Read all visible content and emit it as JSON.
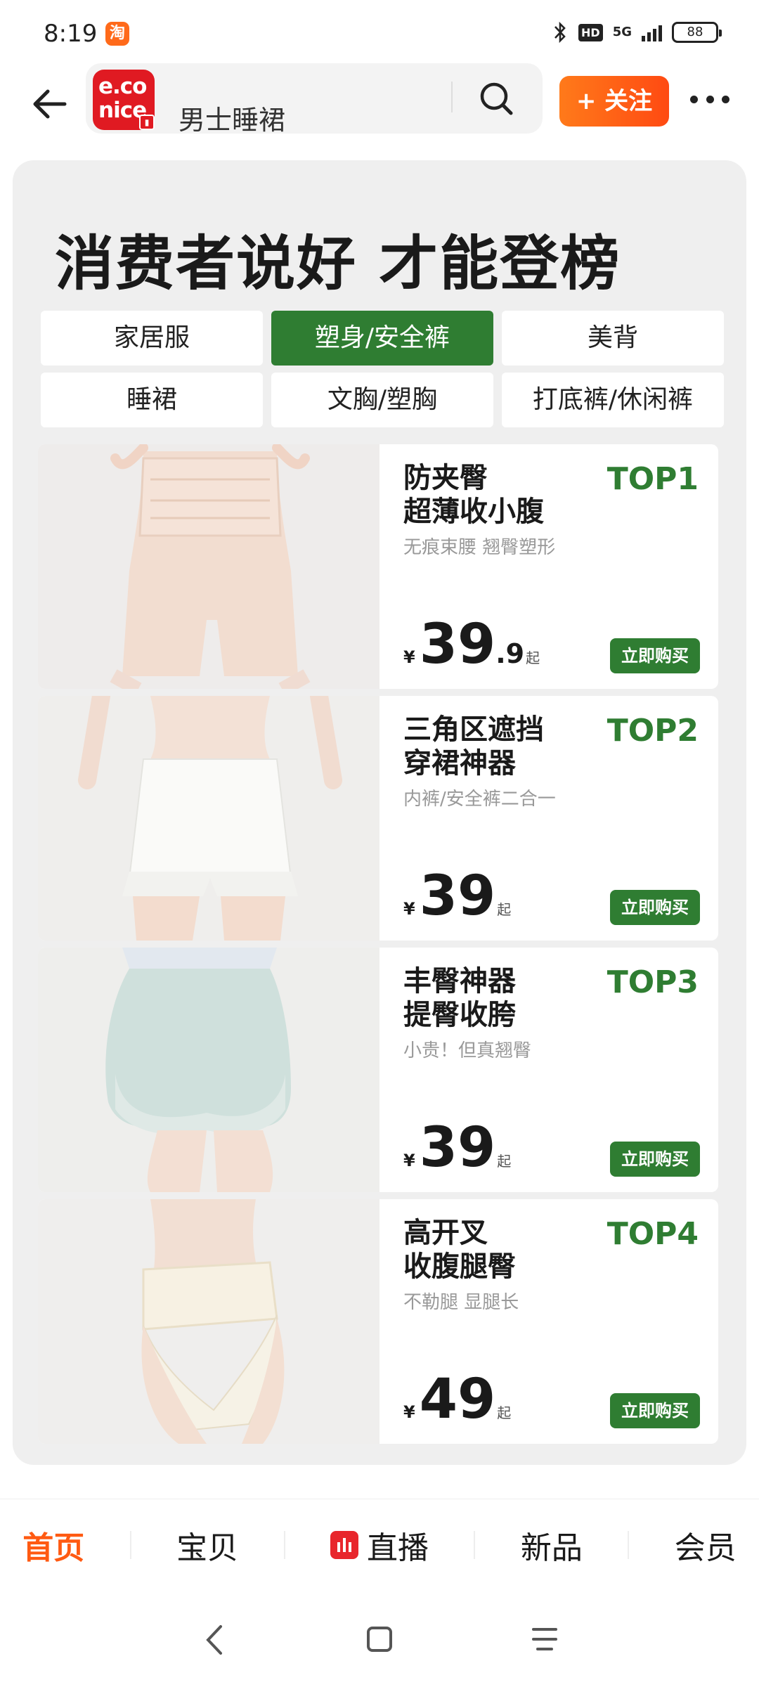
{
  "status_bar": {
    "time": "8:19",
    "app_badge": "淘",
    "hd": "HD",
    "network": "5G",
    "battery": "88"
  },
  "nav": {
    "logo_line1": "e.co",
    "logo_line2": "nice",
    "search_text": "男士睡裙",
    "follow_label": "+ 关注"
  },
  "panel": {
    "headline": "消费者说好 才能登榜",
    "categories": [
      "家居服",
      "塑身/安全裤",
      "美背",
      "睡裙",
      "文胸/塑胸",
      "打底裤/休闲裤"
    ],
    "active_category": "塑身/安全裤"
  },
  "products": [
    {
      "line1": "防夹臀",
      "line2": "超薄收小腹",
      "sub": "无痕束腰 翘臀塑形",
      "rank": "TOP1",
      "currency": "¥",
      "price_int": "39",
      "price_dec": ".9",
      "price_suffix": "起",
      "buy": "立即购买"
    },
    {
      "line1": "三角区遮挡",
      "line2": "穿裙神器",
      "sub": "内裤/安全裤二合一",
      "rank": "TOP2",
      "currency": "¥",
      "price_int": "39",
      "price_dec": "",
      "price_suffix": "起",
      "buy": "立即购买"
    },
    {
      "line1": "丰臀神器",
      "line2": "提臀收胯",
      "sub": "小贵！但真翘臀",
      "rank": "TOP3",
      "currency": "¥",
      "price_int": "39",
      "price_dec": "",
      "price_suffix": "起",
      "buy": "立即购买"
    },
    {
      "line1": "高开叉",
      "line2": "收腹腿臀",
      "sub": "不勒腿 显腿长",
      "rank": "TOP4",
      "currency": "¥",
      "price_int": "49",
      "price_dec": "",
      "price_suffix": "起",
      "buy": "立即购买"
    }
  ],
  "bottom_tabs": [
    "首页",
    "宝贝",
    "直播",
    "新品",
    "会员"
  ],
  "colors": {
    "accent_green": "#2f7d32",
    "accent_orange": "#ff5a12",
    "brand_red": "#e01a22"
  }
}
